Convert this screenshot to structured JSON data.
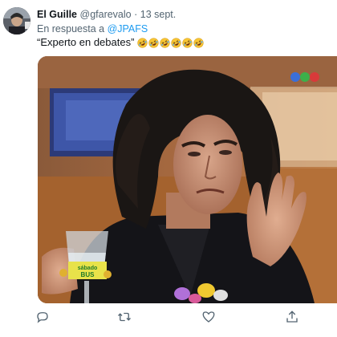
{
  "tweet": {
    "author_name": "El Guille",
    "author_handle": "@gfarevalo",
    "separator": "·",
    "date": "13 sept.",
    "reply_prefix": "En respuesta a ",
    "reply_to": "@JPAFS",
    "text": "“Experto en debates”",
    "emoji": "rolling-on-floor-laughing",
    "emoji_count": 6
  },
  "media": {
    "broadcaster_logo": "three-colored-dots-logo",
    "glass_label": "sábado BUS"
  },
  "actions": [
    {
      "icon": "reply-icon"
    },
    {
      "icon": "retweet-icon"
    },
    {
      "icon": "like-icon"
    },
    {
      "icon": "share-icon"
    }
  ],
  "colors": {
    "link": "#1d9bf0",
    "secondary_text": "#536471",
    "primary_text": "#0f1419"
  }
}
